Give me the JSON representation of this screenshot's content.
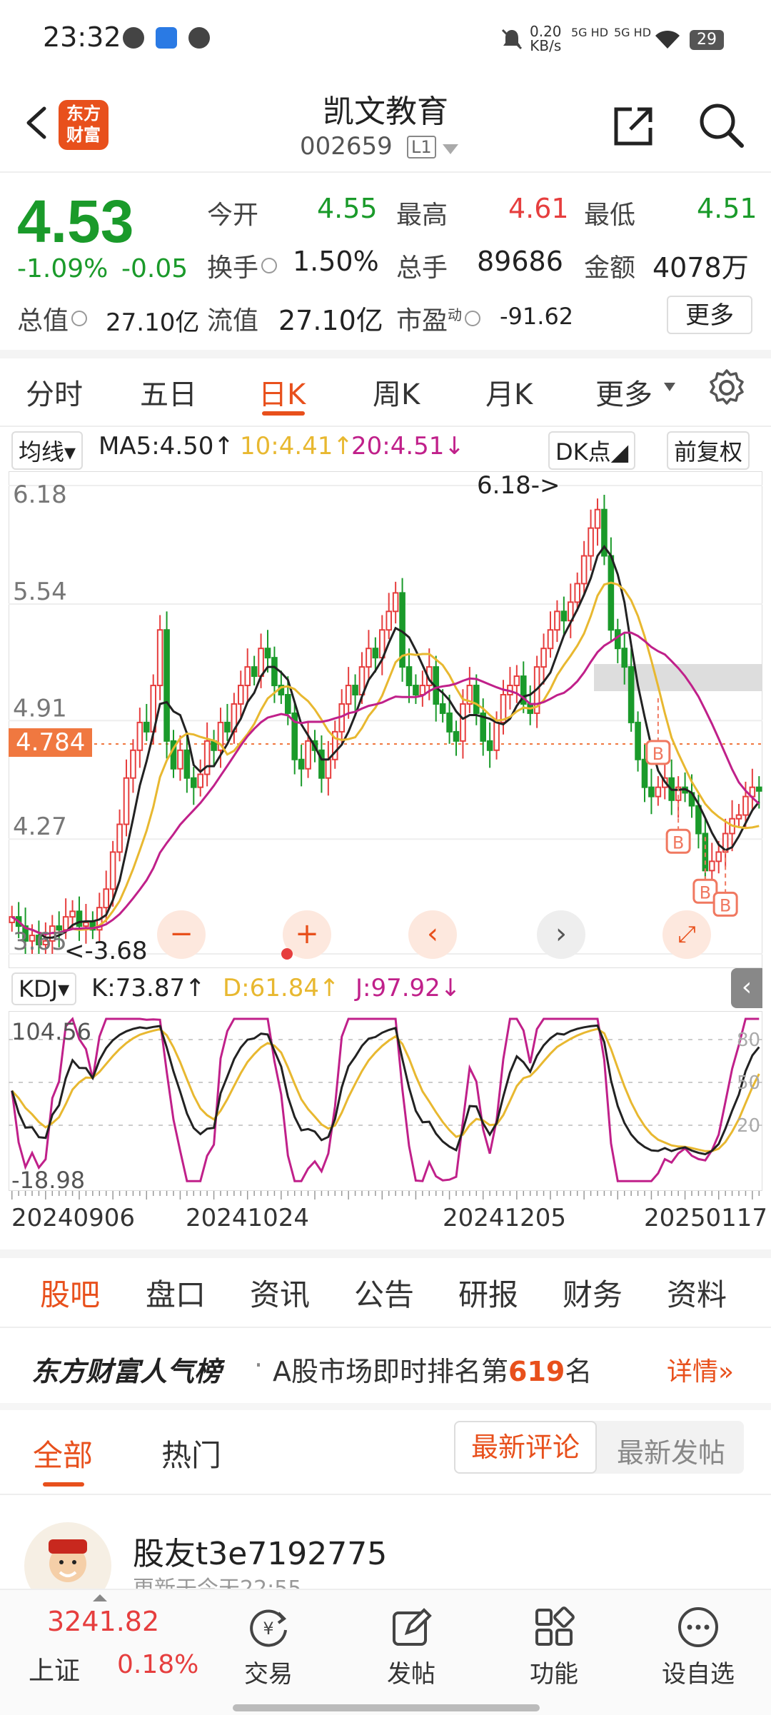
{
  "status_bar": {
    "time": "23:32",
    "net_speed": "0.20",
    "net_unit": "KB/s",
    "signal1": "5G HD",
    "signal2": "5G HD",
    "battery": "29"
  },
  "header": {
    "logo_line1": "东方",
    "logo_line2": "财富",
    "name": "凯文教育",
    "code": "002659",
    "level": "L1"
  },
  "quote": {
    "price": "4.53",
    "change_pct": "-1.09%",
    "change": "-0.05",
    "open_label": "今开",
    "open": "4.55",
    "high_label": "最高",
    "high": "4.61",
    "low_label": "最低",
    "low": "4.51",
    "turnover_label": "换手",
    "turnover": "1.50%",
    "volume_label": "总手",
    "volume": "89686",
    "amount_label": "金额",
    "amount": "4078万",
    "mktcap_label": "总值",
    "mktcap": "27.10亿",
    "float_label": "流值",
    "float": "27.10亿",
    "pe_label": "市盈",
    "pe_sup": "动",
    "pe": "-91.62",
    "more_label": "更多"
  },
  "period_tabs": [
    {
      "label": "分时"
    },
    {
      "label": "五日"
    },
    {
      "label": "日K"
    },
    {
      "label": "周K"
    },
    {
      "label": "月K"
    },
    {
      "label": "更多"
    }
  ],
  "ma_bar": {
    "selector": "均线",
    "ma5": "MA5:4.50",
    "ma10": "10:4.41",
    "ma20": "20:4.51",
    "dk": "DK点",
    "fq": "前复权",
    "arrow_up": "↑",
    "arrow_down": "↓"
  },
  "kline": {
    "y_ticks": [
      "6.18",
      "5.54",
      "4.91",
      "4.27",
      "3.65"
    ],
    "current_price_tag": "4.784",
    "high_annotation": "6.18->",
    "low_annotation": "<-3.68",
    "signal_label": "B"
  },
  "kdj_bar": {
    "selector": "KDJ",
    "k": "K:73.87",
    "d": "D:61.84",
    "j": "J:97.92"
  },
  "kdj": {
    "y_top": "104.56",
    "y_bottom": "-18.98",
    "levels": [
      "80",
      "50",
      "20"
    ]
  },
  "x_dates": [
    "20240906",
    "20241024",
    "20241205",
    "20250117"
  ],
  "colors": {
    "up": "#e63e3e",
    "down": "#1a9a2a",
    "ma5": "#222222",
    "ma10": "#e8b830",
    "ma20": "#c0208a",
    "accent": "#e8501c"
  },
  "bottom_tabs": [
    {
      "label": "股吧"
    },
    {
      "label": "盘口"
    },
    {
      "label": "资讯"
    },
    {
      "label": "公告"
    },
    {
      "label": "研报"
    },
    {
      "label": "财务"
    },
    {
      "label": "资料"
    }
  ],
  "rank": {
    "brand": "东方财富人气榜",
    "dot": "·",
    "text_pre": "A股市场即时排名第",
    "rank": "619",
    "text_post": "名",
    "detail": "详情"
  },
  "filter": {
    "all": "全部",
    "hot": "热门",
    "latest_comment": "最新评论",
    "latest_post": "最新发帖"
  },
  "post": {
    "user": "股友t3e7192775",
    "time": "更新于今天22:55"
  },
  "bottom_nav": {
    "index_value": "3241.82",
    "index_name": "上证",
    "index_pct": "0.18%",
    "items": [
      {
        "label": "交易"
      },
      {
        "label": "发帖"
      },
      {
        "label": "功能"
      },
      {
        "label": "设自选"
      }
    ]
  },
  "chart_data": {
    "type": "candlestick",
    "title": "",
    "ylim": [
      3.65,
      6.18
    ],
    "x_tick_labels": [
      "20240906",
      "20241024",
      "20241205",
      "20250117"
    ],
    "series": [
      {
        "name": "MA5",
        "last": 4.5
      },
      {
        "name": "10",
        "last": 4.41
      },
      {
        "name": "20",
        "last": 4.51
      }
    ],
    "close_series": [
      3.85,
      3.8,
      3.72,
      3.75,
      3.7,
      3.72,
      3.8,
      3.78,
      3.85,
      3.88,
      3.8,
      3.82,
      3.78,
      3.9,
      4.0,
      4.2,
      4.35,
      4.6,
      4.75,
      4.9,
      4.85,
      5.1,
      5.4,
      4.8,
      4.65,
      4.75,
      4.6,
      4.55,
      4.62,
      4.8,
      4.75,
      4.9,
      4.85,
      5.0,
      5.1,
      5.2,
      5.15,
      5.3,
      5.25,
      5.1,
      5.05,
      4.95,
      4.7,
      4.65,
      4.8,
      4.75,
      4.6,
      4.7,
      4.85,
      5.0,
      5.1,
      5.05,
      5.2,
      5.3,
      5.25,
      5.4,
      5.5,
      5.6,
      5.2,
      5.1,
      5.05,
      5.1,
      5.2,
      5.0,
      4.95,
      4.85,
      4.8,
      5.0,
      5.1,
      4.95,
      4.8,
      4.75,
      4.9,
      5.05,
      5.1,
      5.15,
      5.0,
      4.95,
      5.2,
      5.3,
      5.4,
      5.5,
      5.45,
      5.55,
      5.65,
      5.8,
      5.95,
      6.05,
      5.8,
      5.4,
      5.3,
      5.2,
      4.9,
      4.7,
      4.55,
      4.5,
      4.55,
      4.6,
      4.48,
      4.55,
      4.52,
      4.45,
      4.3,
      4.1,
      4.15,
      4.2,
      4.3,
      4.38,
      4.4,
      4.5,
      4.55,
      4.53
    ]
  }
}
